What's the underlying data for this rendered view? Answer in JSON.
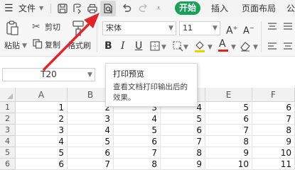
{
  "menubar": {
    "file_label": "文件",
    "tabs": [
      {
        "label": "开始",
        "active": true
      },
      {
        "label": "插入"
      },
      {
        "label": "页面布局"
      },
      {
        "label": "公"
      }
    ]
  },
  "ribbon": {
    "paste_label": "粘贴",
    "cut_label": "剪切",
    "copy_label": "复制",
    "format_painter_label": "格式刷",
    "font_name": "宋体",
    "font_size": "11"
  },
  "tooltip": {
    "title": "打印预览",
    "description": "查看文档打印输出后的效果。"
  },
  "formula_bar": {
    "cell_ref": "T20"
  },
  "grid": {
    "columns": [
      "A",
      "B",
      "C",
      "D",
      "E",
      "F"
    ],
    "rows": [
      {
        "num": "1",
        "cells": [
          "1",
          "2",
          "3",
          "4",
          "5",
          "6"
        ]
      },
      {
        "num": "2",
        "cells": [
          "2",
          "3",
          "4",
          "5",
          "6",
          "7"
        ]
      },
      {
        "num": "3",
        "cells": [
          "3",
          "4",
          "5",
          "6",
          "7",
          "8"
        ]
      },
      {
        "num": "4",
        "cells": [
          "4",
          "5",
          "6",
          "7",
          "8",
          "9"
        ]
      },
      {
        "num": "5",
        "cells": [
          "5",
          "6",
          "7",
          "8",
          "9",
          "10"
        ]
      },
      {
        "num": "6",
        "cells": [
          "6",
          "7",
          "8",
          "9",
          "10",
          "11"
        ]
      }
    ]
  },
  "colors": {
    "accent": "#1aa05a",
    "arrow": "#e0262b",
    "font_color_underline": "#e02020",
    "highlight_underline": "#f2d000"
  }
}
